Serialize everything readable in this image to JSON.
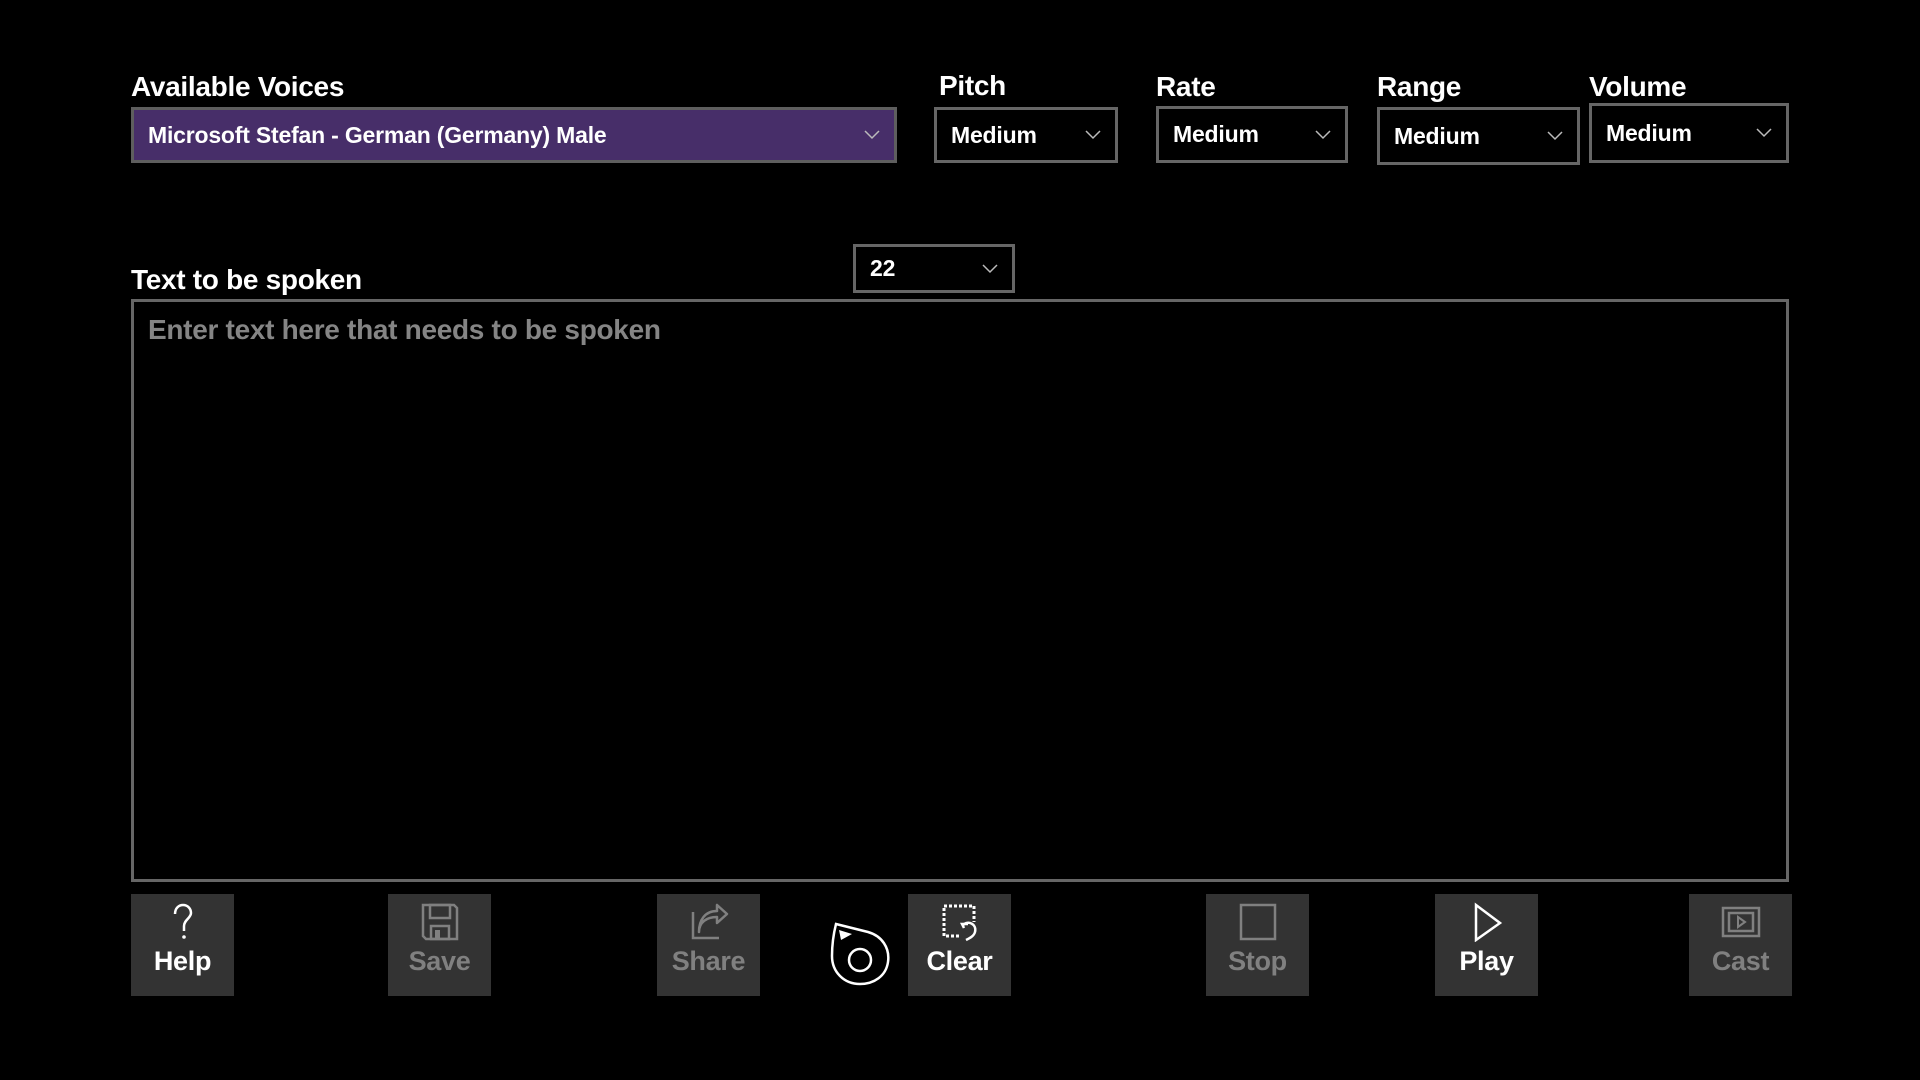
{
  "voices": {
    "label": "Available Voices",
    "selected": "Microsoft Stefan - German (Germany) Male"
  },
  "pitch": {
    "label": "Pitch",
    "selected": "Medium"
  },
  "rate": {
    "label": "Rate",
    "selected": "Medium"
  },
  "range": {
    "label": "Range",
    "selected": "Medium"
  },
  "volume": {
    "label": "Volume",
    "selected": "Medium"
  },
  "font_size": {
    "selected": "22"
  },
  "text_input": {
    "label": "Text to be spoken",
    "value": "",
    "placeholder": "Enter text here that needs to be spoken"
  },
  "toolbar": {
    "help": {
      "label": "Help",
      "icon": "question-icon",
      "enabled": true
    },
    "save": {
      "label": "Save",
      "icon": "floppy-disk-icon",
      "enabled": false
    },
    "share": {
      "label": "Share",
      "icon": "share-icon",
      "enabled": false
    },
    "pen_cursor": {
      "icon": "pen-cursor-icon"
    },
    "clear": {
      "label": "Clear",
      "icon": "clear-selection-icon",
      "enabled": true
    },
    "stop": {
      "label": "Stop",
      "icon": "stop-icon",
      "enabled": false
    },
    "play": {
      "label": "Play",
      "icon": "play-icon",
      "enabled": true
    },
    "cast": {
      "label": "Cast",
      "icon": "cast-icon",
      "enabled": false
    }
  },
  "colors": {
    "accent_purple": "#472e69",
    "button_bg": "#333333",
    "disabled_text": "#808080",
    "border": "#666666"
  }
}
